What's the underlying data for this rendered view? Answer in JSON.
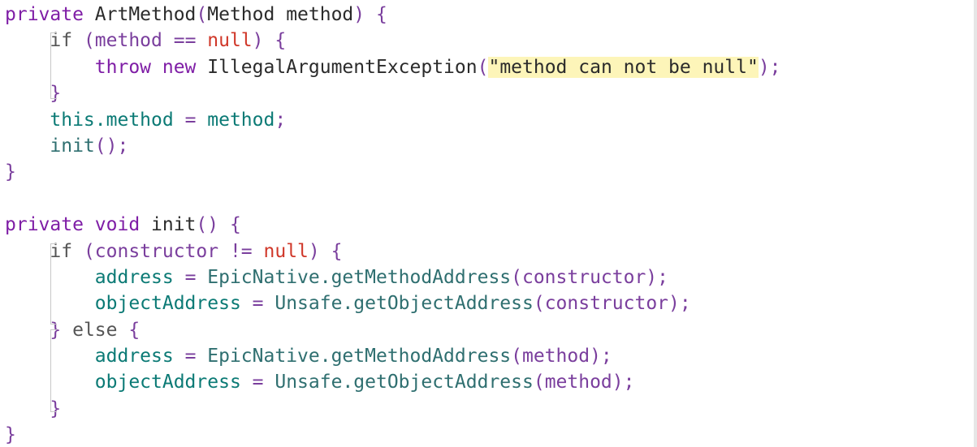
{
  "editor": {
    "lines": [
      "private ArtMethod(Method method) {",
      "    if (method == null) {",
      "        throw new IllegalArgumentException(\"method can not be null\");",
      "    }",
      "    this.method = method;",
      "    init();",
      "}",
      "",
      "private void init() {",
      "    if (constructor != null) {",
      "        address = EpicNative.getMethodAddress(constructor);",
      "        objectAddress = Unsafe.getObjectAddress(constructor);",
      "    } else {",
      "        address = EpicNative.getMethodAddress(method);",
      "        objectAddress = Unsafe.getObjectAddress(method);",
      "    }",
      "}"
    ],
    "colors": {
      "keyword": "#7f1ea6",
      "punctuation": "#7a3e9d",
      "null_literal": "#d0382a",
      "field": "#0b7a75",
      "method_call": "#2f6f70",
      "string_highlight": "#fdf5b9",
      "fold_guide": "#c8c8c8"
    }
  }
}
